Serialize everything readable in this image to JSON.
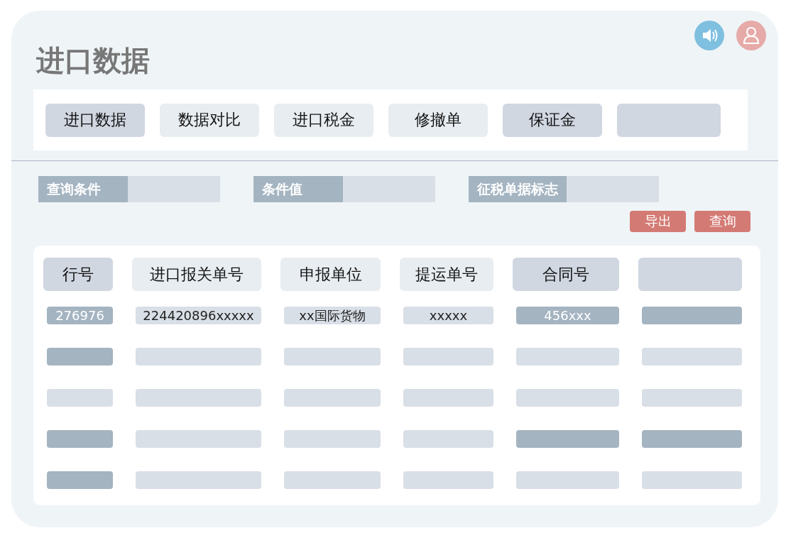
{
  "title": "进口数据",
  "tabs": [
    {
      "label": "进口数据",
      "kind": "dark"
    },
    {
      "label": "数据对比",
      "kind": "light"
    },
    {
      "label": "进口税金",
      "kind": "light"
    },
    {
      "label": "修撤单",
      "kind": "light"
    },
    {
      "label": "保证金",
      "kind": "dark"
    },
    {
      "kind": "dark"
    }
  ],
  "filters": [
    {
      "label": "查询条件"
    },
    {
      "label": "条件值"
    },
    {
      "label": "征税单据标志"
    }
  ],
  "buttons": [
    "导出",
    "查询"
  ],
  "table": {
    "columns": [
      {
        "label": "行号",
        "kind": "dark"
      },
      {
        "label": "进口报关单号",
        "kind": "light"
      },
      {
        "label": "申报单位",
        "kind": "light"
      },
      {
        "label": "提运单号",
        "kind": "light"
      },
      {
        "label": "合同号",
        "kind": "dark"
      },
      {
        "kind": "dark"
      }
    ],
    "rows": [
      [
        {
          "text": "276976",
          "kind": "dark"
        },
        {
          "text": "224420896xxxxx",
          "kind": "light"
        },
        {
          "text": "xx国际货物",
          "kind": "light"
        },
        {
          "text": "xxxxx",
          "kind": "light"
        },
        {
          "text": "456xxx",
          "kind": "dark"
        },
        {
          "kind": "dark"
        }
      ],
      [
        {
          "kind": "dark"
        },
        {
          "kind": "light"
        },
        {
          "kind": "light"
        },
        {
          "kind": "light"
        },
        {
          "kind": "light"
        },
        {
          "kind": "light"
        }
      ],
      [
        {
          "kind": "light"
        },
        {
          "kind": "light"
        },
        {
          "kind": "light"
        },
        {
          "kind": "light"
        },
        {
          "kind": "light"
        },
        {
          "kind": "light"
        }
      ],
      [
        {
          "kind": "dark"
        },
        {
          "kind": "light"
        },
        {
          "kind": "light"
        },
        {
          "kind": "light"
        },
        {
          "kind": "dark"
        },
        {
          "kind": "dark"
        }
      ],
      [
        {
          "kind": "dark"
        },
        {
          "kind": "light"
        },
        {
          "kind": "light"
        },
        {
          "kind": "light"
        },
        {
          "kind": "light"
        },
        {
          "kind": "light"
        }
      ]
    ]
  }
}
